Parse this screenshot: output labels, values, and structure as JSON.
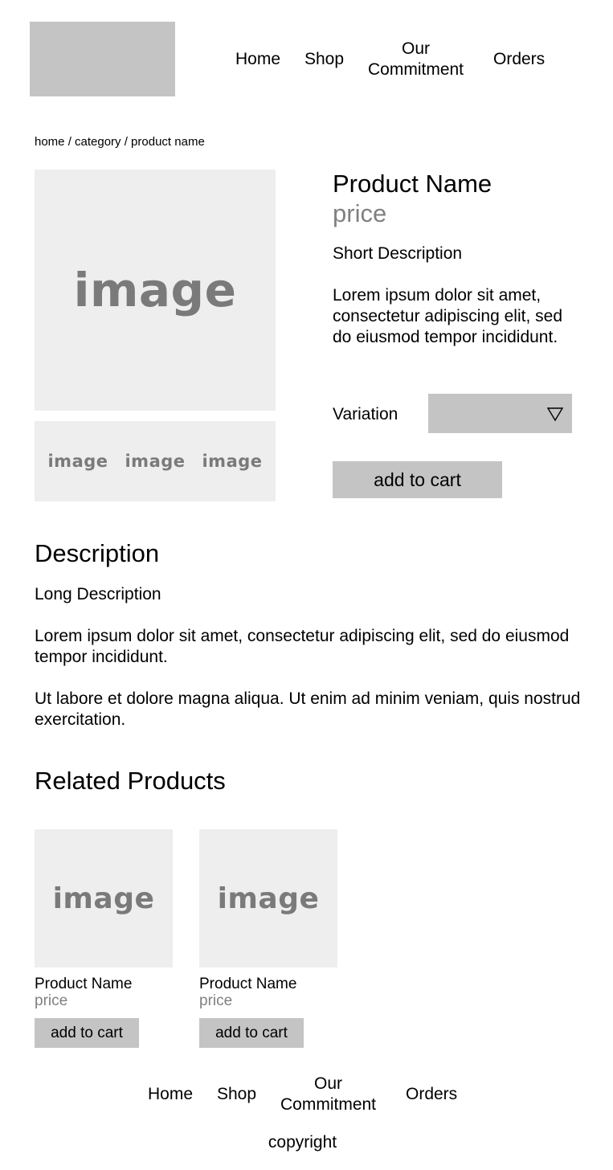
{
  "header": {
    "nav": {
      "home": "Home",
      "shop": "Shop",
      "commitment_line1": "Our",
      "commitment_line2": "Commitment",
      "orders": "Orders"
    }
  },
  "breadcrumb": "home / category / product name",
  "gallery": {
    "main_image_label": "image",
    "thumbnails": [
      "image",
      "image",
      "image"
    ]
  },
  "product": {
    "name": "Product Name",
    "price": "price",
    "short_description_heading": "Short Description",
    "short_description": "Lorem ipsum dolor sit amet, consectetur adipiscing elit, sed do eiusmod tempor incididunt.",
    "variation_label": "Variation",
    "variation_value": "",
    "add_to_cart": "add to cart"
  },
  "description": {
    "title": "Description",
    "long_heading": "Long Description",
    "paragraph1": "Lorem ipsum dolor sit amet, consectetur adipiscing elit, sed do eiusmod tempor incididunt.",
    "paragraph2": "Ut labore et dolore magna aliqua. Ut enim ad minim veniam, quis nostrud exercitation."
  },
  "related": {
    "title": "Related Products",
    "items": [
      {
        "image_label": "image",
        "name": "Product Name",
        "price": "price",
        "button": "add to cart"
      },
      {
        "image_label": "image",
        "name": "Product Name",
        "price": "price",
        "button": "add to cart"
      }
    ]
  },
  "footer": {
    "nav": {
      "home": "Home",
      "shop": "Shop",
      "commitment_line1": "Our",
      "commitment_line2": "Commitment",
      "orders": "Orders"
    },
    "copyright": "copyright"
  },
  "colors": {
    "placeholder_dark": "#c4c4c4",
    "placeholder_light": "#eeeeee",
    "muted_text": "#808080"
  },
  "icons": {
    "variation_dropdown": "triangle-down-outline-icon"
  }
}
